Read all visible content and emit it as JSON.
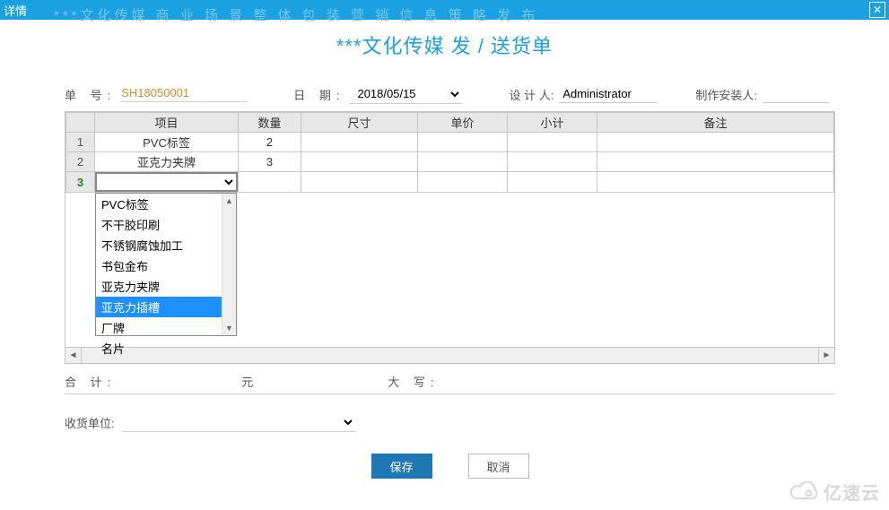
{
  "titlebar": {
    "title": "详情"
  },
  "bg_tagline": "***文化传媒      商 业 场 景 整 体 包 装      营 销 信 息 策 略 发 布",
  "doc_title": "***文化传媒   发 / 送货单",
  "form": {
    "order_label": "单  号:",
    "order_no": "SH18050001",
    "date_label": "日  期:",
    "date_value": "2018/05/15",
    "designer_label": "设 计 人:",
    "designer_value": "Administrator",
    "installer_label": "制作安装人:"
  },
  "table": {
    "headers": {
      "item": "项目",
      "qty": "数量",
      "size": "尺寸",
      "price": "单价",
      "subtotal": "小计",
      "note": "备注"
    },
    "rows": [
      {
        "n": "1",
        "item": "PVC标签",
        "qty": "2",
        "size": "",
        "price": "",
        "subtotal": "",
        "note": ""
      },
      {
        "n": "2",
        "item": "亚克力夹牌",
        "qty": "3",
        "size": "",
        "price": "",
        "subtotal": "",
        "note": ""
      },
      {
        "n": "3",
        "item": "",
        "qty": "",
        "size": "",
        "price": "",
        "subtotal": "",
        "note": ""
      }
    ]
  },
  "dropdown": {
    "options": [
      "PVC标签",
      "不干胶印刷",
      "不锈钢腐蚀加工",
      "书包金布",
      "亚克力夹牌",
      "亚克力插槽",
      "厂牌",
      "名片"
    ],
    "selected_index": 5
  },
  "summary": {
    "total_label": "合  计:",
    "yuan_label": "元",
    "caps_label": "大  写:"
  },
  "receiver": {
    "label": "收货单位:"
  },
  "buttons": {
    "save": "保存",
    "cancel": "取消"
  },
  "watermark": "亿速云"
}
